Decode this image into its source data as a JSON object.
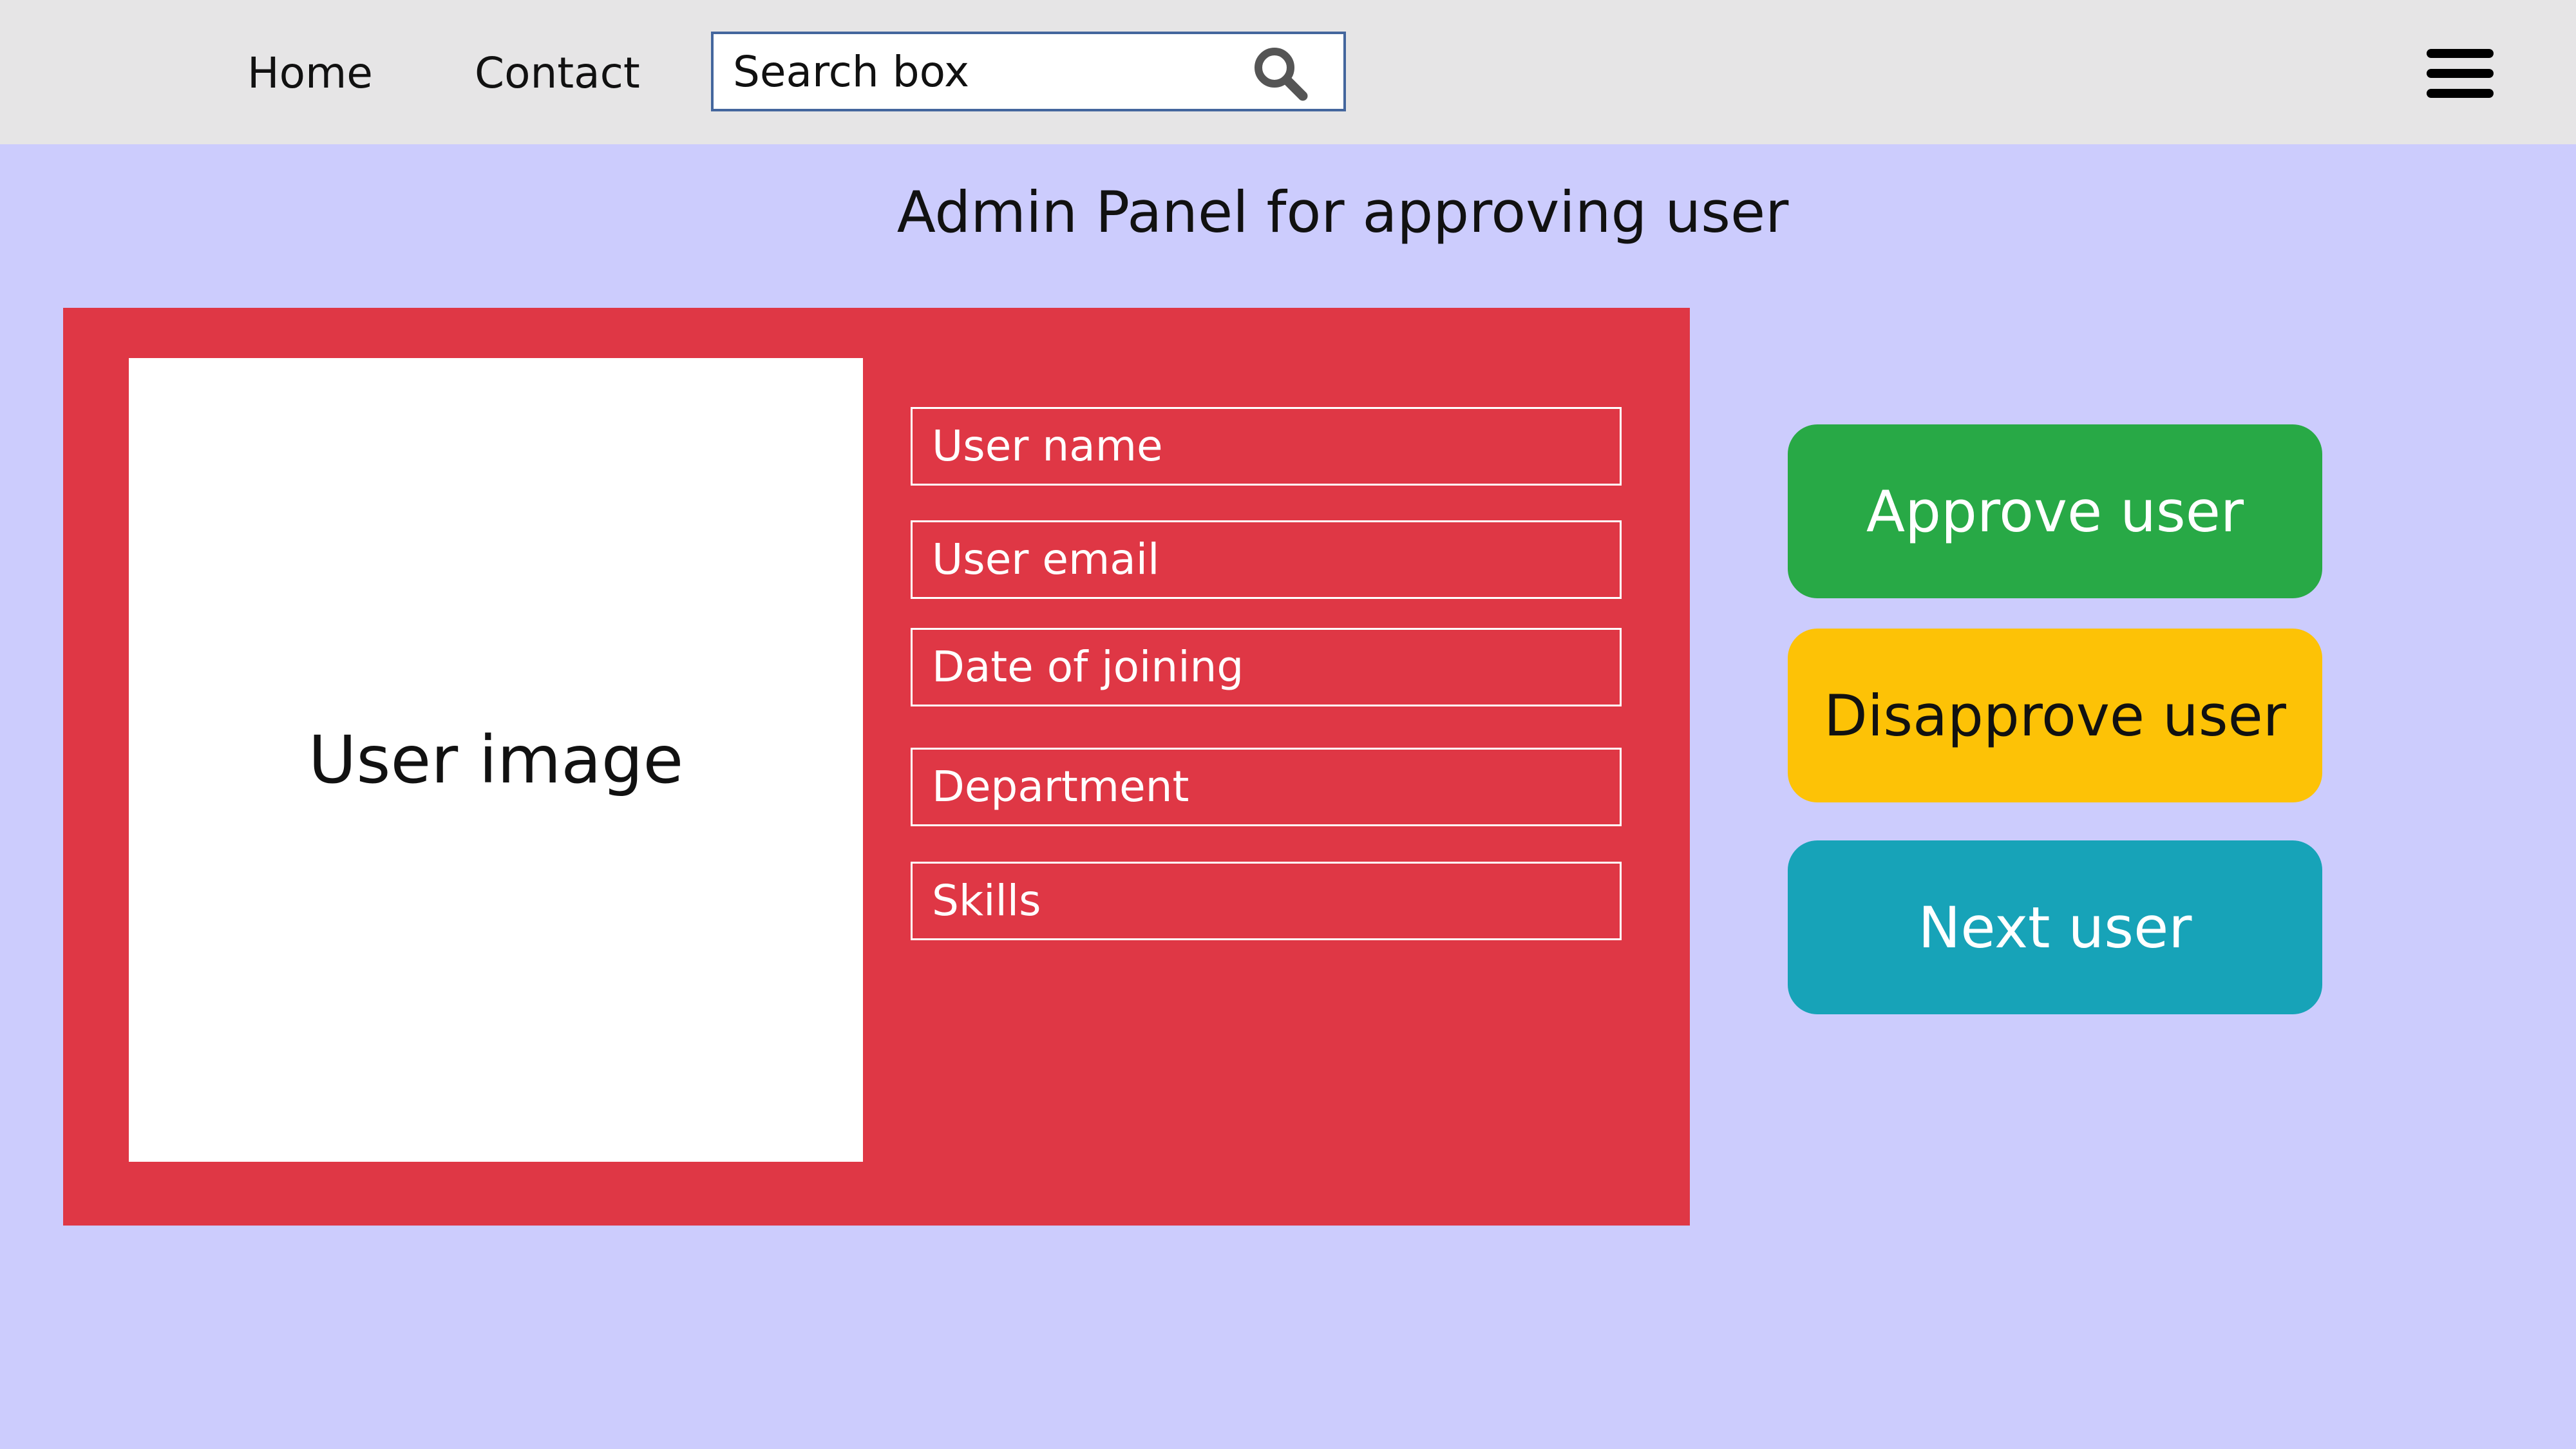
{
  "nav": {
    "home": "Home",
    "contact": "Contact"
  },
  "search": {
    "placeholder": "Search box",
    "icon": "search-icon"
  },
  "menu": {
    "icon": "hamburger-menu-icon"
  },
  "page": {
    "title": "Admin Panel for approving user"
  },
  "user_card": {
    "image_label": "User image",
    "fields": {
      "name": "User name",
      "email": "User email",
      "date_of_joining": "Date of joining",
      "department": "Department",
      "skills": "Skills"
    }
  },
  "actions": {
    "approve": "Approve user",
    "disapprove": "Disapprove user",
    "next": "Next user"
  },
  "colors": {
    "page_background": "#ccccfd",
    "topbar_background": "#e6e5e6",
    "card_background": "#df3745",
    "approve": "#28a946",
    "disapprove": "#fdc206",
    "next": "#17a3b8"
  }
}
